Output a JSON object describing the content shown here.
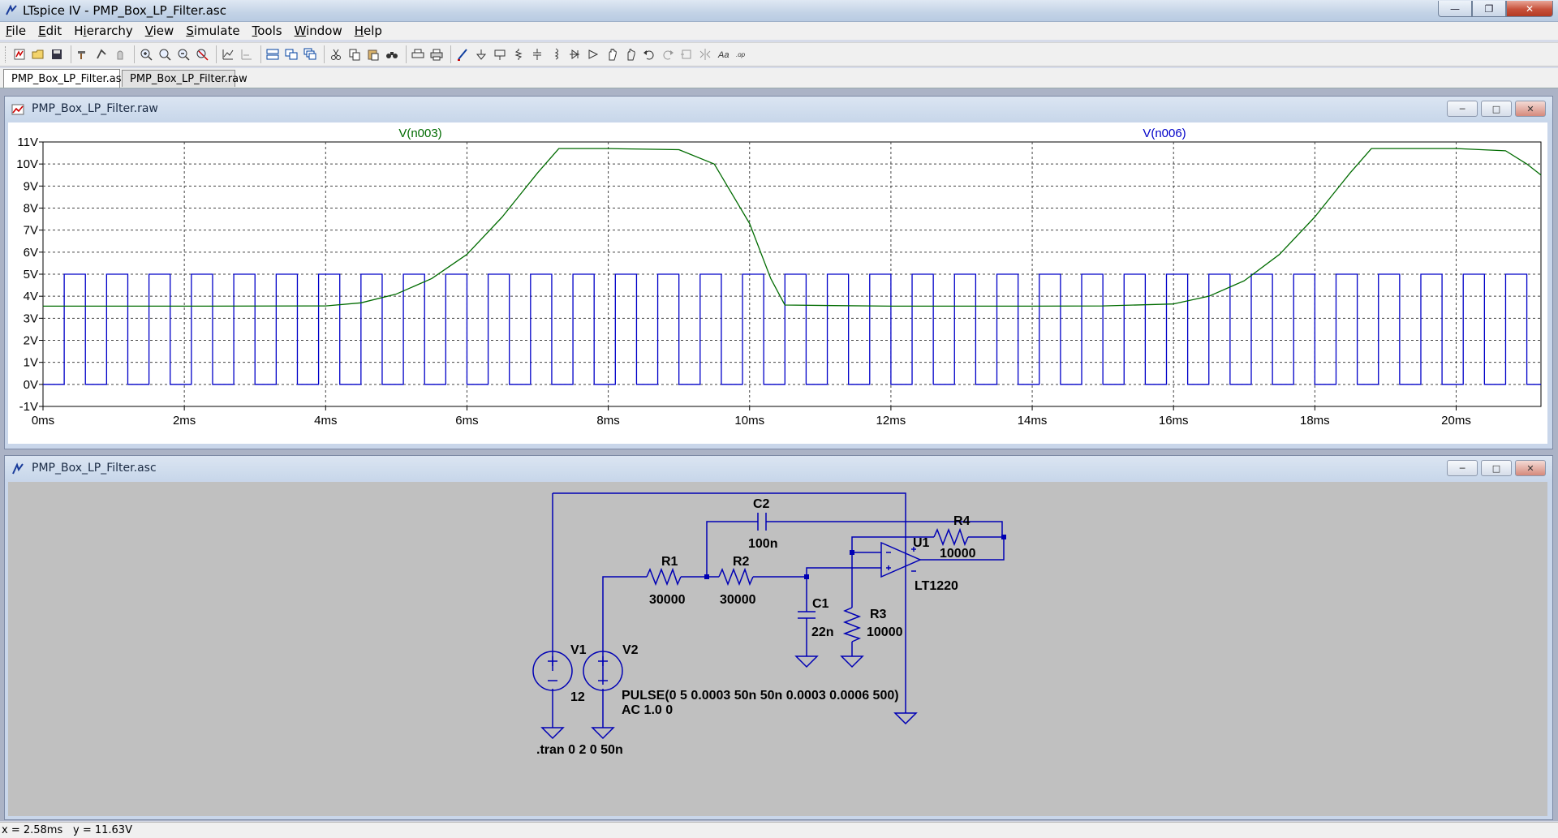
{
  "window": {
    "title": "LTspice IV - PMP_Box_LP_Filter.asc"
  },
  "menu": [
    {
      "label": "File",
      "key": "F"
    },
    {
      "label": "Edit",
      "key": "E"
    },
    {
      "label": "Hierarchy",
      "key": "i"
    },
    {
      "label": "View",
      "key": "V"
    },
    {
      "label": "Simulate",
      "key": "S"
    },
    {
      "label": "Tools",
      "key": "T"
    },
    {
      "label": "Window",
      "key": "W"
    },
    {
      "label": "Help",
      "key": "H"
    }
  ],
  "toolbar_icons": [
    "new-schematic-icon",
    "open-icon",
    "save-icon",
    "hammer-control-panel-icon",
    "run-icon",
    "halt-icon",
    "zoom-in-icon",
    "zoom-pan-icon",
    "zoom-out-icon",
    "zoom-cancel-icon",
    "autorange-icon",
    "zoom-back-icon",
    "tile-horizontal-icon",
    "tile-vertical-icon",
    "cascade-icon",
    "cut-icon",
    "copy-icon",
    "paste-icon",
    "find-icon",
    "print-setup-icon",
    "print-icon",
    "draw-wire-icon",
    "ground-icon",
    "label-net-icon",
    "resistor-icon",
    "capacitor-icon",
    "inductor-icon",
    "diode-icon",
    "component-icon",
    "move-icon",
    "drag-icon",
    "undo-icon",
    "redo-icon",
    "rotate-icon",
    "mirror-icon",
    "text-icon",
    "spice-directive-icon"
  ],
  "tabs": [
    {
      "label": "PMP_Box_LP_Filter.asc",
      "active": true
    },
    {
      "label": "PMP_Box_LP_Filter.raw",
      "active": false
    }
  ],
  "plot_window": {
    "title": "PMP_Box_LP_Filter.raw"
  },
  "schematic_window": {
    "title": "PMP_Box_LP_Filter.asc"
  },
  "chart_data": {
    "type": "line",
    "x_unit": "ms",
    "xlim": [
      0,
      21.2
    ],
    "ylim": [
      -1,
      11
    ],
    "x_ticks": [
      "0ms",
      "2ms",
      "4ms",
      "6ms",
      "8ms",
      "10ms",
      "12ms",
      "14ms",
      "16ms",
      "18ms",
      "20ms"
    ],
    "y_ticks": [
      "11V",
      "10V",
      "9V",
      "8V",
      "7V",
      "6V",
      "5V",
      "4V",
      "3V",
      "2V",
      "1V",
      "0V",
      "-1V"
    ],
    "grid": true,
    "series": [
      {
        "name": "V(n003)",
        "color": "#006b00",
        "x": [
          0,
          2,
          4,
          4.5,
          5,
          5.5,
          6,
          6.5,
          7,
          7.3,
          7.5,
          8,
          9,
          9.5,
          10,
          10.3,
          10.5,
          12,
          14,
          15,
          16,
          16.5,
          17,
          17.5,
          18,
          18.5,
          18.8,
          19,
          20,
          20.7,
          21,
          21.2
        ],
        "values": [
          3.55,
          3.55,
          3.56,
          3.7,
          4.1,
          4.8,
          5.9,
          7.6,
          9.6,
          10.7,
          10.7,
          10.7,
          10.65,
          10.0,
          7.3,
          4.8,
          3.6,
          3.55,
          3.55,
          3.56,
          3.65,
          4.0,
          4.7,
          5.9,
          7.6,
          9.6,
          10.7,
          10.7,
          10.7,
          10.6,
          10.0,
          9.5
        ]
      },
      {
        "name": "V(n006)",
        "color": "#0000c8",
        "waveform": "pulse",
        "low": 0,
        "high": 5,
        "delay_ms": 0.3,
        "width_ms": 0.3,
        "period_ms": 0.6
      }
    ]
  },
  "schematic": {
    "components": [
      {
        "ref": "C2",
        "value": "100n"
      },
      {
        "ref": "R4",
        "value": "10000"
      },
      {
        "ref": "U1",
        "value": "LT1220"
      },
      {
        "ref": "R1",
        "value": "30000"
      },
      {
        "ref": "R2",
        "value": "30000"
      },
      {
        "ref": "C1",
        "value": "22n"
      },
      {
        "ref": "R3",
        "value": "10000"
      },
      {
        "ref": "V1",
        "value": "12"
      },
      {
        "ref": "V2",
        "value": "PULSE(0 5 0.0003 50n 50n 0.0003 0.0006 500)",
        "value2": "AC 1.0 0"
      }
    ],
    "directive": ".tran 0 2 0 50n"
  },
  "status": {
    "x": "x = 2.58ms",
    "y": "y = 11.63V"
  }
}
